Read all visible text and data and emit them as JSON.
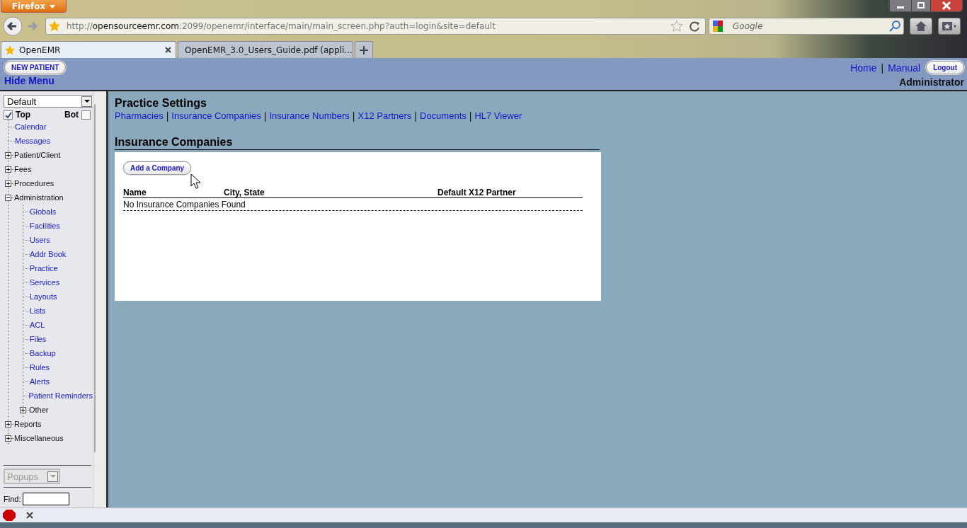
{
  "browser": {
    "menu_button": "Firefox",
    "url": {
      "host_prefix": "http://",
      "host": "opensourceemr.com",
      "path": ":2099/openemr/interface/main/main_screen.php?auth=login&site=default"
    },
    "search": {
      "placeholder": "Google"
    },
    "tabs": [
      {
        "label": "OpenEMR",
        "selected": true,
        "kind": "star"
      },
      {
        "label": "OpenEMR_3.0_Users_Guide.pdf (appli...",
        "selected": false,
        "kind": "page"
      }
    ]
  },
  "header": {
    "new_patient": "NEW PATIENT",
    "hide_menu": "Hide Menu",
    "links": [
      "Home",
      "Manual"
    ],
    "separator": "|",
    "logout": "Logout",
    "user": "Administrator"
  },
  "sidebar": {
    "layout_select": "Default",
    "top": {
      "label": "Top",
      "checked": true
    },
    "bot": {
      "label": "Bot",
      "checked": false
    },
    "tree": [
      {
        "label": "Calendar",
        "kind": "link"
      },
      {
        "label": "Messages",
        "kind": "link"
      },
      {
        "label": "Patient/Client",
        "kind": "folder",
        "expanded": false
      },
      {
        "label": "Fees",
        "kind": "folder",
        "expanded": false
      },
      {
        "label": "Procedures",
        "kind": "folder",
        "expanded": false
      },
      {
        "label": "Administration",
        "kind": "folder",
        "expanded": true,
        "children": [
          {
            "label": "Globals",
            "kind": "link"
          },
          {
            "label": "Facilities",
            "kind": "link"
          },
          {
            "label": "Users",
            "kind": "link"
          },
          {
            "label": "Addr Book",
            "kind": "link"
          },
          {
            "label": "Practice",
            "kind": "link"
          },
          {
            "label": "Services",
            "kind": "link"
          },
          {
            "label": "Layouts",
            "kind": "link"
          },
          {
            "label": "Lists",
            "kind": "link"
          },
          {
            "label": "ACL",
            "kind": "link"
          },
          {
            "label": "Files",
            "kind": "link"
          },
          {
            "label": "Backup",
            "kind": "link"
          },
          {
            "label": "Rules",
            "kind": "link"
          },
          {
            "label": "Alerts",
            "kind": "link"
          },
          {
            "label": "Patient Reminders",
            "kind": "link"
          },
          {
            "label": "Other",
            "kind": "folder",
            "expanded": false
          }
        ]
      },
      {
        "label": "Reports",
        "kind": "folder",
        "expanded": false
      },
      {
        "label": "Miscellaneous",
        "kind": "folder",
        "expanded": false
      }
    ],
    "popups": "Popups",
    "find_label": "Find:"
  },
  "main": {
    "title": "Practice Settings",
    "nav": [
      "Pharmacies",
      "Insurance Companies",
      "Insurance Numbers",
      "X12 Partners",
      "Documents",
      "HL7 Viewer"
    ],
    "nav_separator": "|",
    "section": "Insurance Companies",
    "add_button": "Add a Company",
    "table": {
      "columns": [
        "Name",
        "City, State",
        "Default X12 Partner"
      ],
      "empty": "No Insurance Companies Found"
    }
  }
}
